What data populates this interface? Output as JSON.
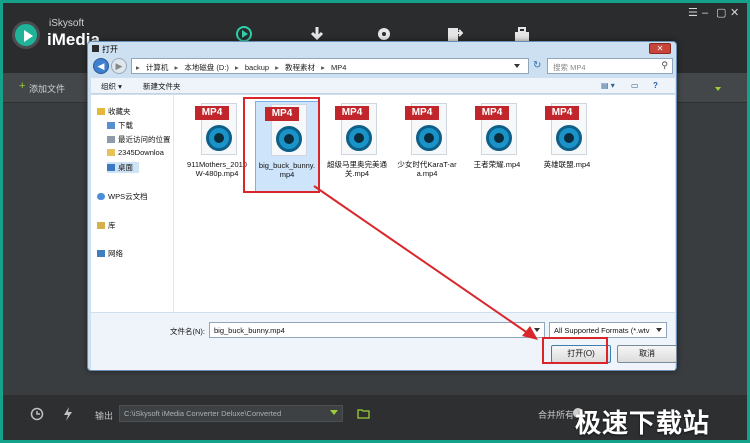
{
  "app": {
    "brand_small": "iSkysoft",
    "brand_big": "iMedia",
    "add_files": "添加文件",
    "window_controls": [
      "☰",
      "–",
      "▢",
      "✕"
    ]
  },
  "footer": {
    "output_label": "输出",
    "output_path": "C:\\iSkysoft iMedia Converter Deluxe\\Converted",
    "merge_label": "合并所有",
    "watermark": "极速下载站"
  },
  "dialog": {
    "title": "打开",
    "breadcrumb": [
      "计算机",
      "本地磁盘 (D:)",
      "backup",
      "教程素材",
      "MP4"
    ],
    "search_placeholder": "搜索 MP4",
    "cmd_organize": "组织 ▾",
    "cmd_new_folder": "新建文件夹",
    "nav_items": [
      {
        "label": "收藏夹",
        "icon": "star-icon",
        "color": "#e4b83a"
      },
      {
        "label": "下载",
        "icon": "download-folder-icon",
        "color": "#5a8fcf"
      },
      {
        "label": "最近访问的位置",
        "icon": "recent-places-icon",
        "color": "#8c9aab"
      },
      {
        "label": "2345Downloa",
        "icon": "folder-icon",
        "color": "#e8c15a"
      },
      {
        "label": "桌面",
        "icon": "desktop-icon",
        "color": "#3a78c2"
      },
      {
        "label": "WPS云文档",
        "icon": "cloud-icon",
        "color": "#4a90d9"
      },
      {
        "label": "库",
        "icon": "library-icon",
        "color": "#d6b04a"
      },
      {
        "label": "网络",
        "icon": "network-icon",
        "color": "#3f7fbf"
      }
    ],
    "files": [
      {
        "tag": "MP4",
        "name": "911Mothers_2010W-480p.mp4"
      },
      {
        "tag": "MP4",
        "name": "big_buck_bunny.mp4"
      },
      {
        "tag": "MP4",
        "name": "超级马里奥完美通关.mp4"
      },
      {
        "tag": "MP4",
        "name": "少女时代KaraT-ara.mp4"
      },
      {
        "tag": "MP4",
        "name": "王者荣耀.mp4"
      },
      {
        "tag": "MP4",
        "name": "英雄联盟.mp4"
      }
    ],
    "filename_label": "文件名(N):",
    "filename_value": "big_buck_bunny.mp4",
    "format_value": "All Supported Formats (*.wtv",
    "open_button": "打开(O)",
    "cancel_button": "取消"
  },
  "colors": {
    "frame": "#14a38a",
    "accent": "#9ccf3a",
    "highlight": "#d9262b"
  }
}
